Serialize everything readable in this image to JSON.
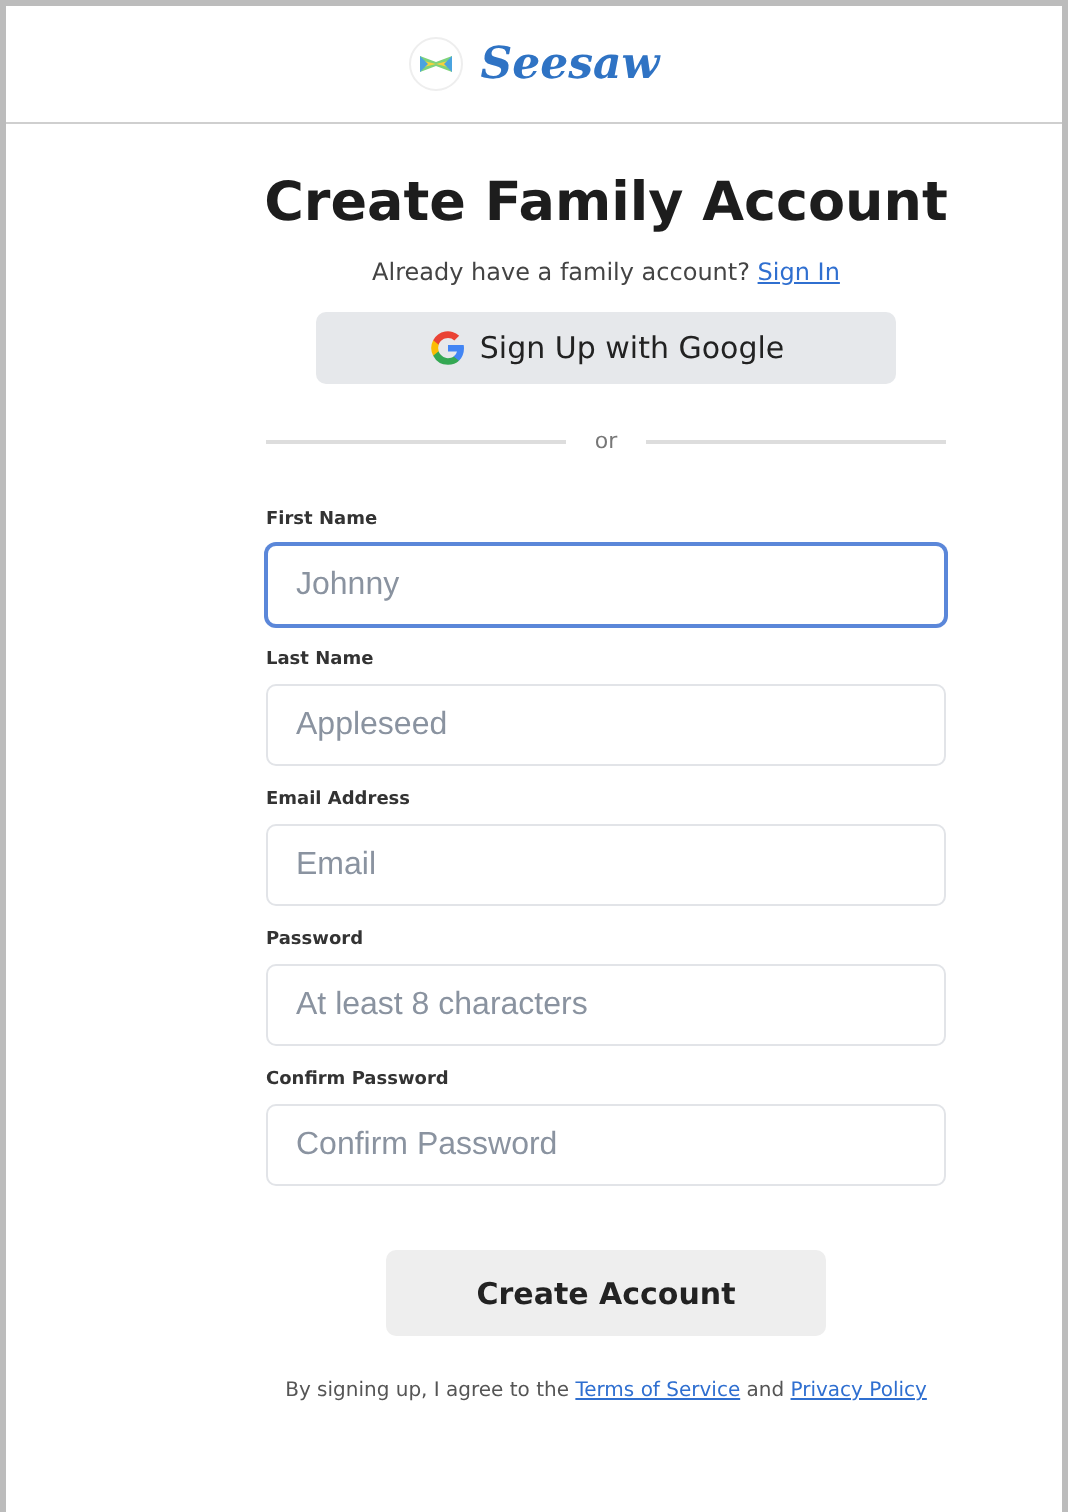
{
  "header": {
    "logo_text": "Seesaw"
  },
  "title": "Create Family Account",
  "signin_prompt": {
    "text": "Already have a family account?",
    "link": "Sign In"
  },
  "google_button": "Sign Up with Google",
  "divider": "or",
  "fields": [
    {
      "label": "First Name",
      "placeholder": "Johnny",
      "focused": true
    },
    {
      "label": "Last Name",
      "placeholder": "Appleseed",
      "focused": false
    },
    {
      "label": "Email Address",
      "placeholder": "Email",
      "focused": false
    },
    {
      "label": "Password",
      "placeholder": "At least 8 characters",
      "focused": false
    },
    {
      "label": "Confirm Password",
      "placeholder": "Confirm Password",
      "focused": false
    }
  ],
  "submit_button": "Create Account",
  "terms": {
    "text": "By signing up, I agree to the",
    "link_1": "Terms of Service",
    "joiner": "and",
    "link_2": "Privacy Policy"
  }
}
